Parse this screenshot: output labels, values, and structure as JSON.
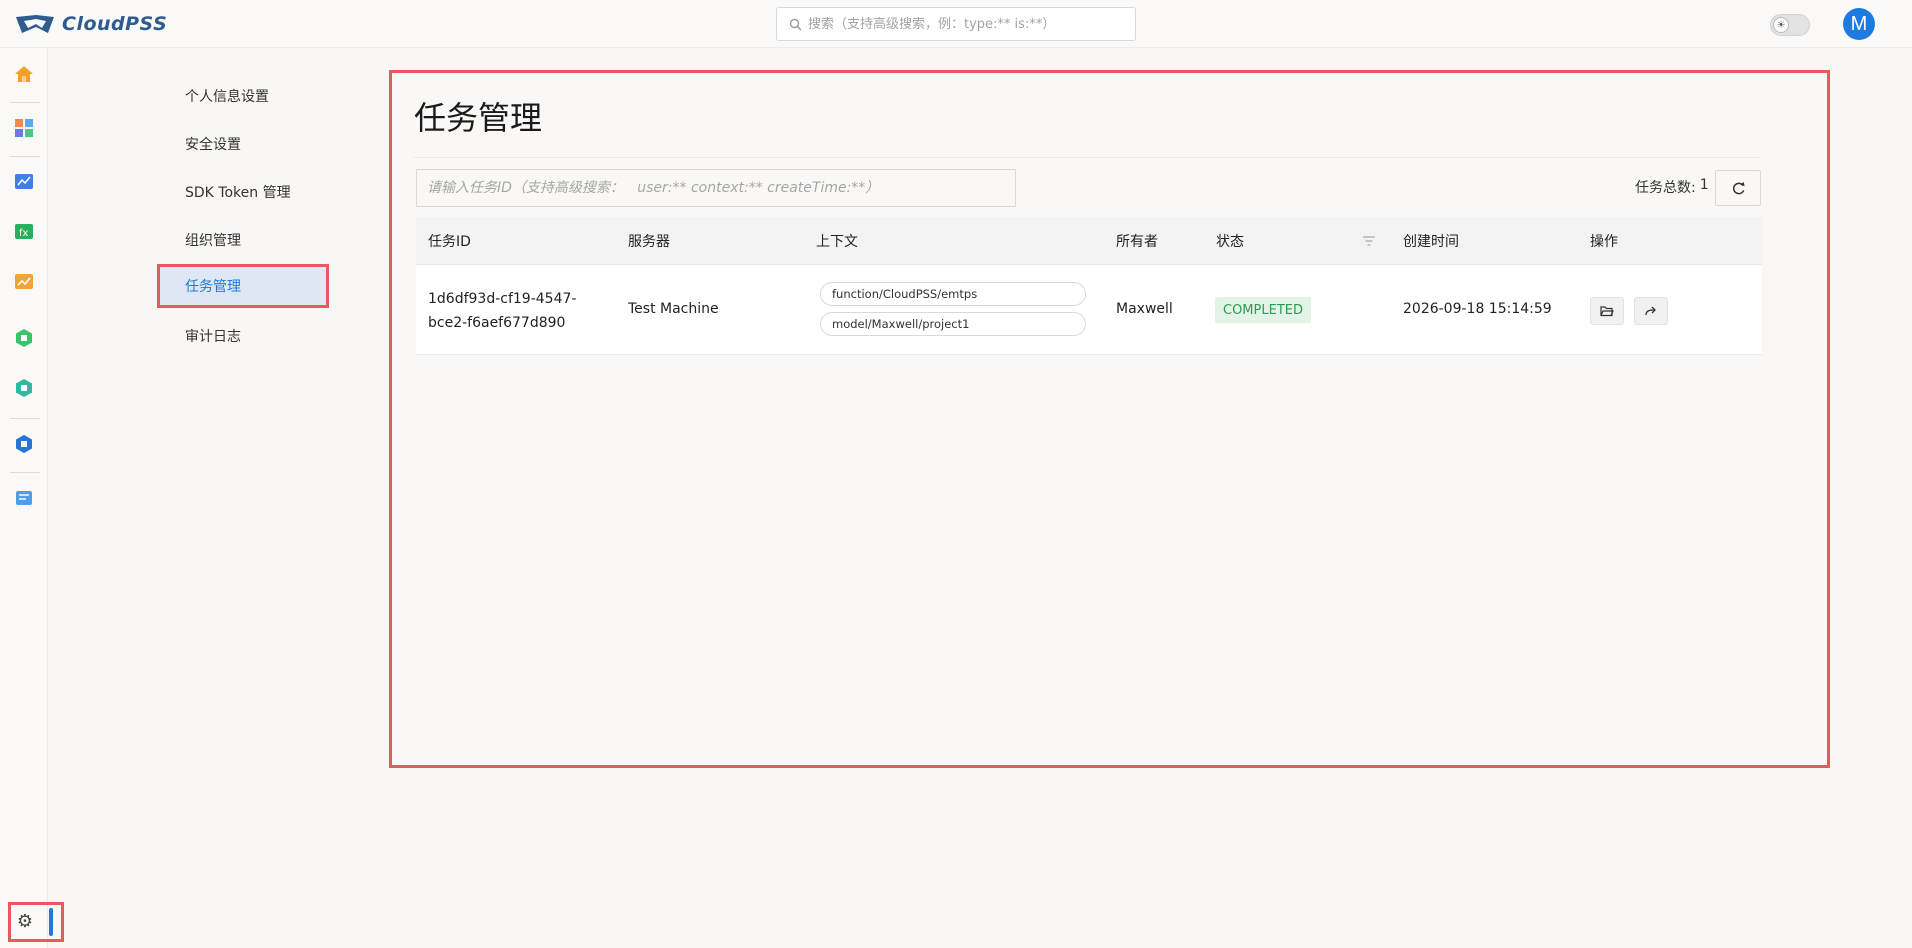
{
  "app": {
    "logo_text": "CloudPSS"
  },
  "header": {
    "search_placeholder": "搜索（支持高级搜索，例：type:** is:**）",
    "avatar_letter": "M"
  },
  "settings_menu": {
    "items": [
      {
        "label": "个人信息设置",
        "active": false
      },
      {
        "label": "安全设置",
        "active": false
      },
      {
        "label": "SDK Token 管理",
        "active": false
      },
      {
        "label": "组织管理",
        "active": false
      },
      {
        "label": "任务管理",
        "active": true
      },
      {
        "label": "审计日志",
        "active": false
      }
    ]
  },
  "main": {
    "title": "任务管理",
    "search_placeholder": "请输入任务ID（支持高级搜索：   user:** context:** createTime:**）",
    "task_count_label": "任务总数:",
    "task_count": "1",
    "table": {
      "headers": {
        "task_id": "任务ID",
        "server": "服务器",
        "context": "上下文",
        "owner": "所有者",
        "status": "状态",
        "created": "创建时间",
        "actions": "操作"
      },
      "rows": [
        {
          "task_id_line1": "1d6df93d-cf19-4547-",
          "task_id_line2": "bce2-f6aef677d890",
          "server": "Test Machine",
          "context": [
            "function/CloudPSS/emtps",
            "model/Maxwell/project1"
          ],
          "owner": "Maxwell",
          "status": "COMPLETED",
          "created": "2026-09-18 15:14:59"
        }
      ]
    }
  },
  "colors": {
    "accent": "#1d7ae0",
    "highlight_border": "#e55b5e",
    "status_completed": "#2a9d52"
  },
  "icons": {
    "rail": [
      "home-icon",
      "apps-icon",
      "chart-app-icon",
      "function-app-icon",
      "trend-app-icon",
      "hexagon-green-icon",
      "hexagon-teal-icon",
      "hexagon-blue-icon",
      "document-icon"
    ],
    "settings": "gear-icon",
    "refresh": "refresh-icon",
    "open_folder": "folder-open-icon",
    "share": "share-icon",
    "filter": "filter-icon"
  }
}
